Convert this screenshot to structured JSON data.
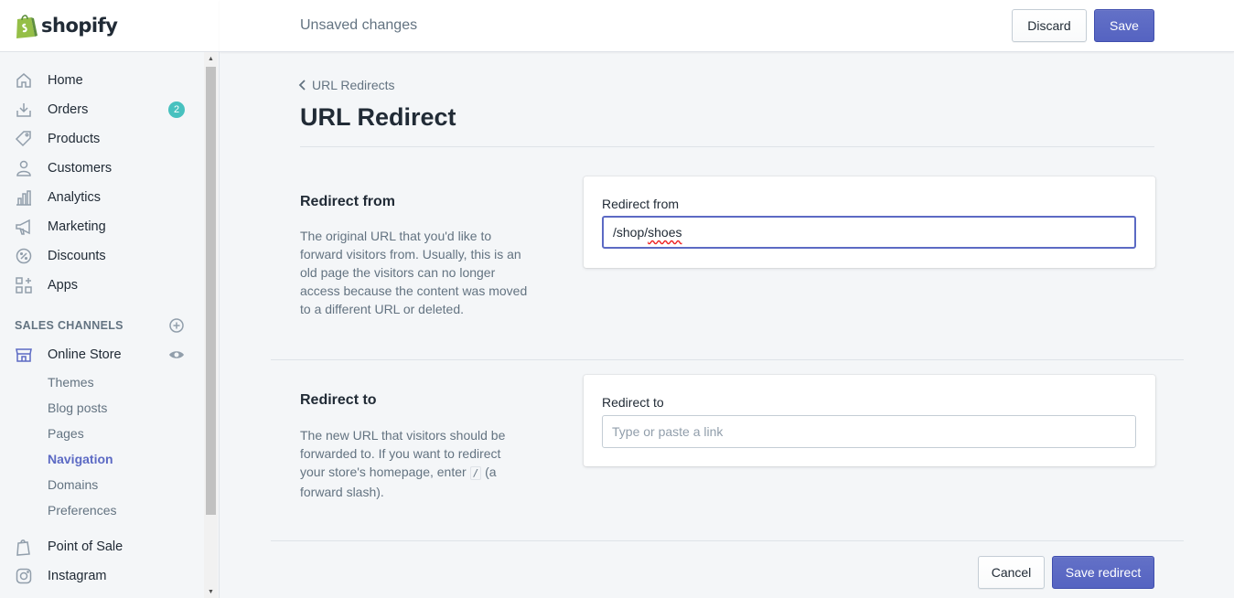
{
  "app": {
    "brand": "shopify"
  },
  "topbar": {
    "status": "Unsaved changes",
    "discard_label": "Discard",
    "save_label": "Save"
  },
  "sidebar": {
    "items": [
      {
        "label": "Home",
        "icon": "home-icon"
      },
      {
        "label": "Orders",
        "icon": "orders-icon",
        "badge": "2"
      },
      {
        "label": "Products",
        "icon": "tag-icon"
      },
      {
        "label": "Customers",
        "icon": "person-icon"
      },
      {
        "label": "Analytics",
        "icon": "bar-chart-icon"
      },
      {
        "label": "Marketing",
        "icon": "megaphone-icon"
      },
      {
        "label": "Discounts",
        "icon": "discount-icon"
      },
      {
        "label": "Apps",
        "icon": "apps-icon"
      }
    ],
    "channels_title": "SALES CHANNELS",
    "online_store": {
      "label": "Online Store",
      "subitems": [
        "Themes",
        "Blog posts",
        "Pages",
        "Navigation",
        "Domains",
        "Preferences"
      ],
      "active": "Navigation"
    },
    "point_of_sale": "Point of Sale",
    "instagram": "Instagram"
  },
  "page": {
    "breadcrumb": "URL Redirects",
    "title": "URL Redirect"
  },
  "redirect_from": {
    "heading": "Redirect from",
    "description": "The original URL that you'd like to forward visitors from. Usually, this is an old page the visitors can no longer access because the content was moved to a different URL or deleted.",
    "field_label": "Redirect from",
    "value_prefix": "/shop/",
    "value_suffix": "shoes"
  },
  "redirect_to": {
    "heading": "Redirect to",
    "description_before": "The new URL that visitors should be forwarded to. If you want to redirect your store's homepage, enter",
    "description_code": "/",
    "description_after": "(a forward slash).",
    "field_label": "Redirect to",
    "placeholder": "Type or paste a link"
  },
  "footer": {
    "cancel_label": "Cancel",
    "save_redirect_label": "Save redirect"
  },
  "colors": {
    "primary": "#5c6ac4",
    "badge": "#47c1bf",
    "muted": "#637381"
  }
}
